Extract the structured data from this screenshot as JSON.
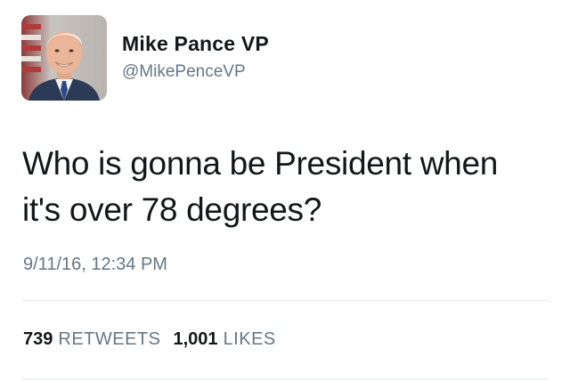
{
  "tweet": {
    "author": {
      "display_name": "Mike Pance VP",
      "handle": "@MikePenceVP",
      "avatar_icon": "profile-photo"
    },
    "text_lines": [
      "Who is gonna be President when",
      "it's over 78 degrees?"
    ],
    "timestamp": "9/11/16, 12:34 PM",
    "stats": {
      "retweets_count": "739",
      "retweets_label": "RETWEETS",
      "likes_count": "1,001",
      "likes_label": "LIKES"
    }
  },
  "colors": {
    "primary_text": "#14171a",
    "secondary_text": "#657786",
    "divider": "#e1e8ed",
    "background": "#ffffff"
  }
}
